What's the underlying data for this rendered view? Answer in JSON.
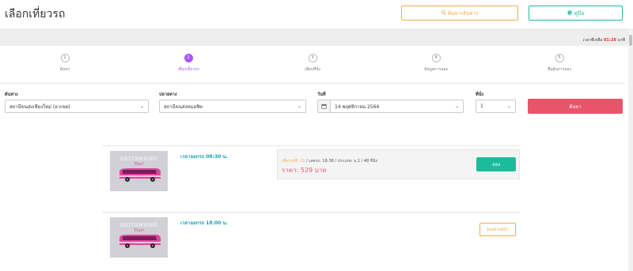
{
  "header": {
    "title": "เลือกเที่ยวรถ",
    "search_route_label": "ค้นหาเส้นทาง",
    "manual_label": "คู่มือ"
  },
  "timer": {
    "label": "เวลาที่เหลือ",
    "value": "01:28",
    "unit": "นาที"
  },
  "steps": [
    {
      "number": "1",
      "label": "ค้นหา",
      "active": false
    },
    {
      "number": "2",
      "label": "เลือกเที่ยวรถ",
      "active": true
    },
    {
      "number": "3",
      "label": "เลือกที่นั่ง",
      "active": false
    },
    {
      "number": "4",
      "label": "ข้อมูลการจอง",
      "active": false
    },
    {
      "number": "5",
      "label": "ยืนยันการจอง",
      "active": false
    }
  ],
  "search": {
    "origin_label": "ต้นทาง",
    "origin_value": "สถานีขนส่งเชียงใหม่ (อาเขต)",
    "destination_label": "ปลายทาง",
    "destination_value": "สถานีขนส่งหมอชิต",
    "date_label": "วันที่",
    "date_value": "14 พฤศจิกายน 2564",
    "seats_label": "ที่นั่ง",
    "seats_value": "1",
    "search_button": "ค้นหา"
  },
  "trips": [
    {
      "logo_text": "SRITAWONG",
      "logo_sub": "Tour",
      "depart_label": "เวลาออกรถ 08:30 น.",
      "trip_no_label": "เที่ยวรถที่: 21",
      "details": " / เลขรถ: 18-36 / ประเภท: ม.1 / 48 ที่นั่ง",
      "price": "ราคา: 529 บาท",
      "book_button": "จอง"
    },
    {
      "logo_text": "SRITAWONG",
      "logo_sub": "Tour",
      "depart_label": "เวลาออกรถ 18:00 น.",
      "notify_button": "จองล่วงหน้า"
    }
  ],
  "colors": {
    "accent_purple": "#a855f7",
    "green": "#1abc9c",
    "orange": "#f0ad4e",
    "red": "#e8546a",
    "teal_text": "#17a2b8"
  }
}
